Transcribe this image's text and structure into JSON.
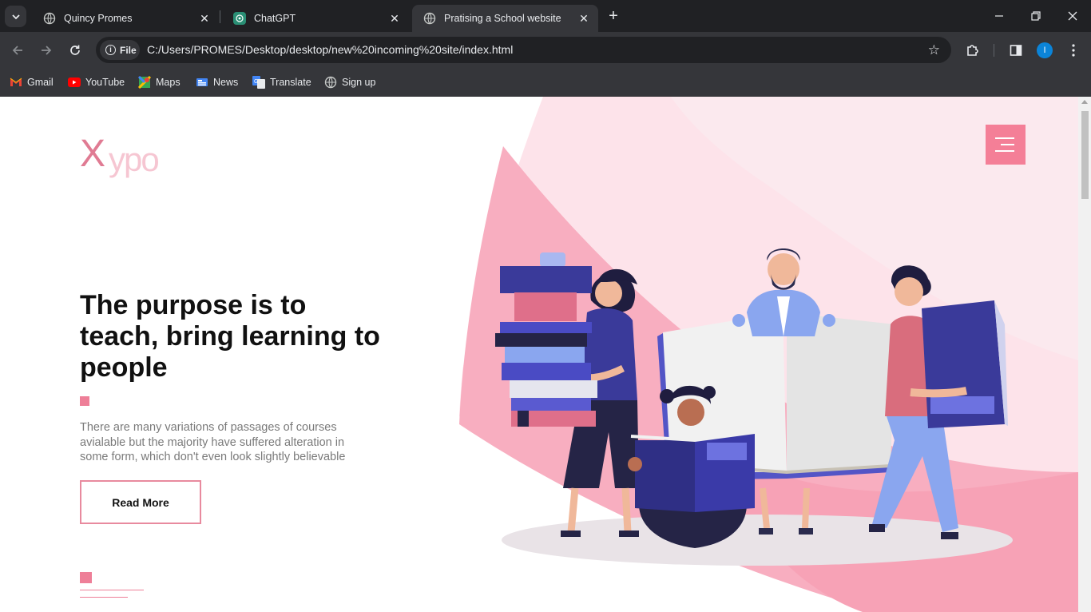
{
  "browser": {
    "tabs": [
      {
        "title": "Quincy Promes",
        "active": false
      },
      {
        "title": "ChatGPT",
        "active": false
      },
      {
        "title": "Pratising a School website",
        "active": true
      }
    ],
    "address": {
      "chip_label": "File",
      "url": "C:/Users/PROMES/Desktop/desktop/new%20incoming%20site/index.html"
    },
    "profile_initial": "I",
    "bookmarks": [
      {
        "label": "Gmail",
        "icon": "gmail-icon"
      },
      {
        "label": "YouTube",
        "icon": "youtube-icon"
      },
      {
        "label": "Maps",
        "icon": "maps-icon"
      },
      {
        "label": "News",
        "icon": "news-icon"
      },
      {
        "label": "Translate",
        "icon": "translate-icon"
      },
      {
        "label": "Sign up",
        "icon": "globe-icon"
      }
    ]
  },
  "site": {
    "logo": {
      "first": "X",
      "rest": "ypo"
    },
    "hero": {
      "title": "The purpose is to teach, bring learning to people",
      "text": "There are many variations of passages of courses avialable but the majority have suffered alteration in some form, which don't even look slightly believable",
      "button_label": "Read More"
    },
    "colors": {
      "accent": "#f47f97",
      "logo_dark": "#e07b93",
      "logo_light": "#f6c6d2"
    }
  }
}
